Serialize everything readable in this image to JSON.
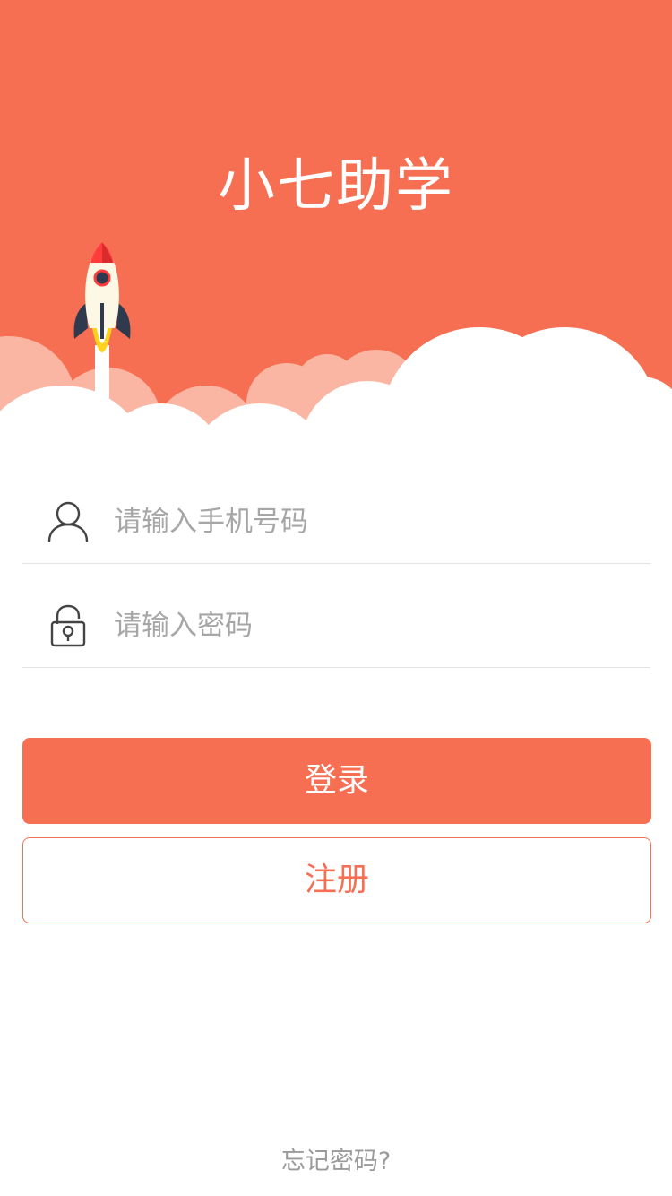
{
  "colors": {
    "brand": "#f76f52",
    "cloud_back": "#fbb6a3",
    "cloud_front": "#ffffff",
    "placeholder": "#a6a6a6",
    "divider": "#e2e2e2",
    "forgot_text": "#9a9a9a"
  },
  "header": {
    "title": "小七助学",
    "illustration": "rocket-launch-over-clouds"
  },
  "form": {
    "phone": {
      "icon": "user-icon",
      "placeholder": "请输入手机号码",
      "value": ""
    },
    "password": {
      "icon": "lock-icon",
      "placeholder": "请输入密码",
      "value": ""
    }
  },
  "actions": {
    "login_label": "登录",
    "register_label": "注册",
    "forgot_label": "忘记密码?"
  }
}
